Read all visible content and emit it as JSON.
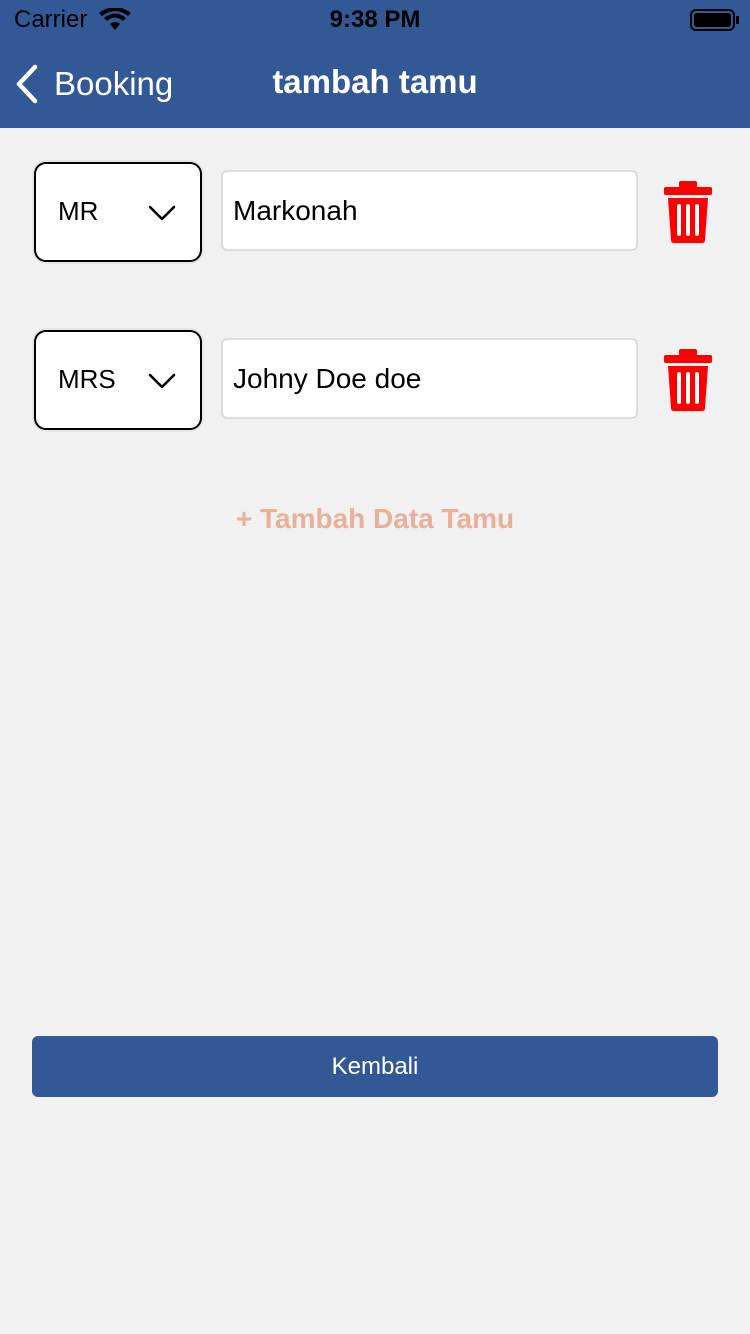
{
  "status_bar": {
    "carrier": "Carrier",
    "time": "9:38 PM"
  },
  "nav": {
    "back_label": "Booking",
    "title": "tambah tamu"
  },
  "guests": [
    {
      "title": "MR",
      "name": "Markonah"
    },
    {
      "title": "MRS",
      "name": "Johny Doe doe"
    }
  ],
  "add_guest_label": "+ Tambah Data Tamu",
  "footer": {
    "back_button_label": "Kembali"
  },
  "colors": {
    "brand": "#325995",
    "background": "#f1f1f1",
    "delete": "#ff0000",
    "add_link": "#e8b09b"
  },
  "icons": {
    "wifi": "wifi-icon",
    "battery": "battery-icon",
    "back": "chevron-left-icon",
    "dropdown": "chevron-down-icon",
    "delete": "trash-icon"
  }
}
